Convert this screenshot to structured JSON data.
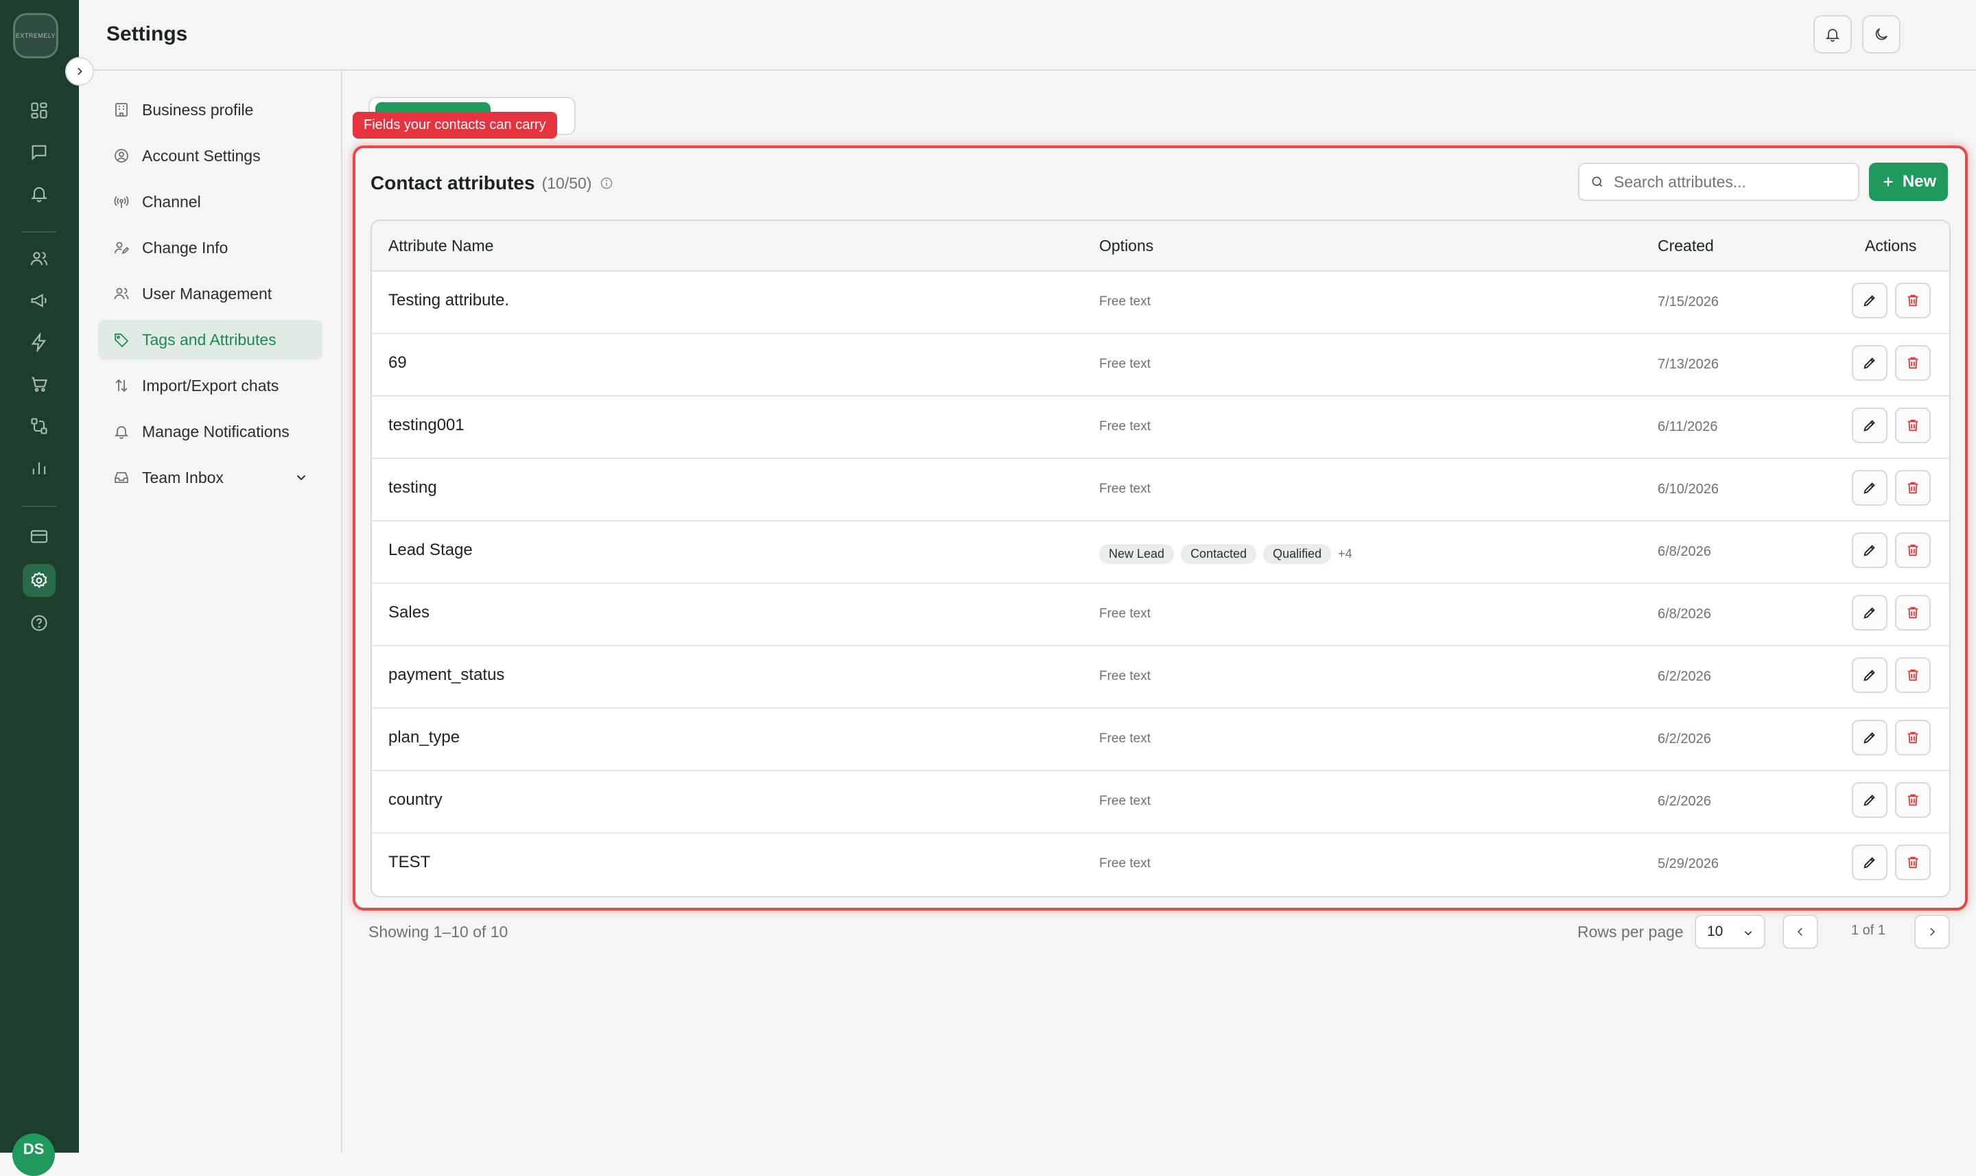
{
  "rail": {
    "logo_text": "EXTREMELY",
    "user_initials": "DS"
  },
  "header": {
    "title": "Settings"
  },
  "settings_nav": {
    "items": [
      {
        "label": "Business profile",
        "icon": "building-icon"
      },
      {
        "label": "Account Settings",
        "icon": "user-circle-icon"
      },
      {
        "label": "Channel",
        "icon": "broadcast-icon"
      },
      {
        "label": "Change Info",
        "icon": "user-edit-icon"
      },
      {
        "label": "User Management",
        "icon": "users-icon"
      },
      {
        "label": "Tags and Attributes",
        "icon": "tag-icon",
        "active": true
      },
      {
        "label": "Import/Export chats",
        "icon": "arrows-updown-icon"
      },
      {
        "label": "Manage Notifications",
        "icon": "bell-icon"
      },
      {
        "label": "Team Inbox",
        "icon": "inbox-icon",
        "has_chevron": true
      }
    ]
  },
  "tooltip": {
    "text": "Fields your contacts can carry"
  },
  "card": {
    "title": "Contact attributes",
    "count": "(10/50)",
    "search_placeholder": "Search attributes...",
    "new_label": "New"
  },
  "table": {
    "headers": {
      "name": "Attribute Name",
      "options": "Options",
      "created": "Created",
      "actions": "Actions"
    },
    "rows": [
      {
        "name": "Testing attribute.",
        "options": "Free text",
        "created": "7/15/2026"
      },
      {
        "name": "69",
        "options": "Free text",
        "created": "7/13/2026"
      },
      {
        "name": "testing001",
        "options": "Free text",
        "created": "6/11/2026"
      },
      {
        "name": "testing",
        "options": "Free text",
        "created": "6/10/2026"
      },
      {
        "name": "Lead Stage",
        "options": "",
        "chips": [
          "New Lead",
          "Contacted",
          "Qualified"
        ],
        "more": "+4",
        "created": "6/8/2026"
      },
      {
        "name": "Sales",
        "options": "Free text",
        "created": "6/8/2026"
      },
      {
        "name": "payment_status",
        "options": "Free text",
        "created": "6/2/2026"
      },
      {
        "name": "plan_type",
        "options": "Free text",
        "created": "6/2/2026"
      },
      {
        "name": "country",
        "options": "Free text",
        "created": "6/2/2026"
      },
      {
        "name": "TEST",
        "options": "Free text",
        "created": "5/29/2026"
      }
    ]
  },
  "footer": {
    "showing": "Showing 1–10 of 10",
    "rows_per_page_label": "Rows per page",
    "rows_per_page_value": "10",
    "page_info": "1 of 1"
  },
  "colors": {
    "brand": "#1f9a5c",
    "rail": "#1e3e2d",
    "highlight": "#e54a4a"
  }
}
